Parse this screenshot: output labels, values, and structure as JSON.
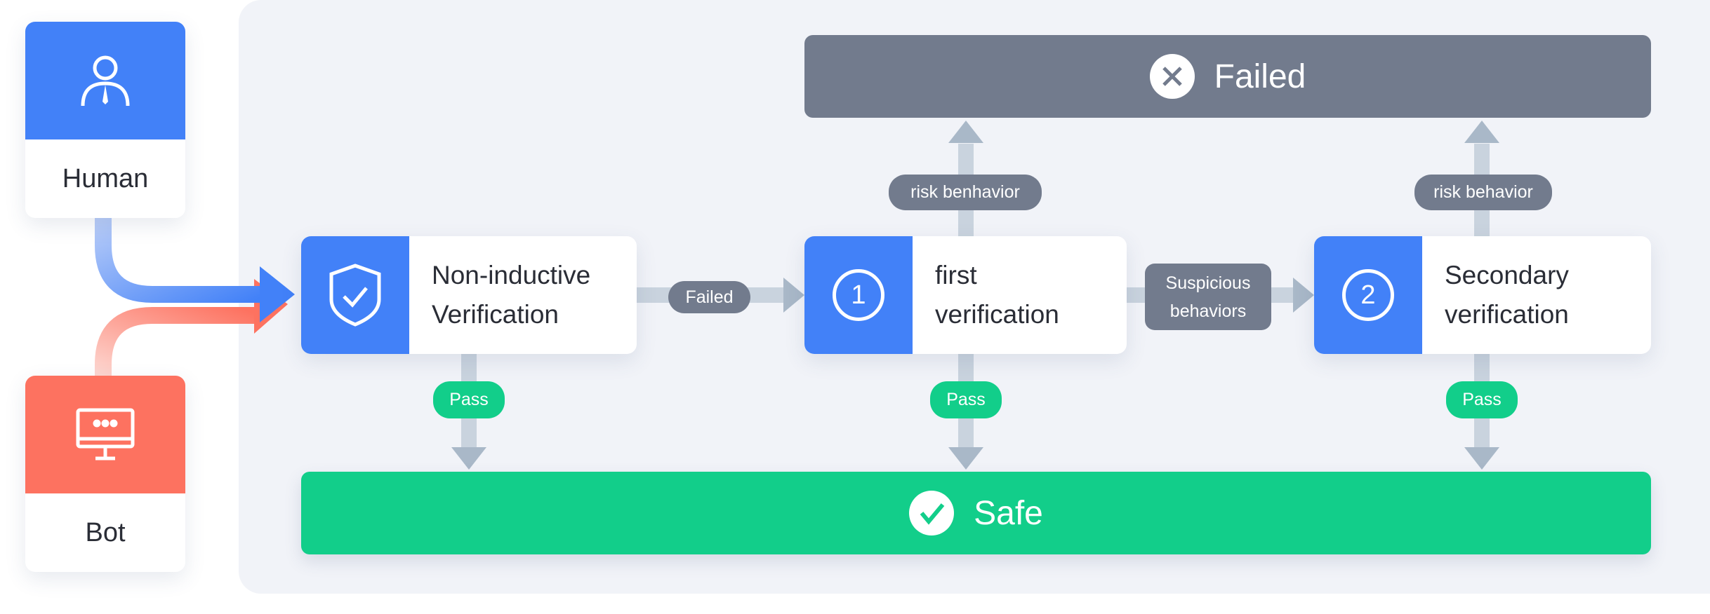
{
  "sources": [
    {
      "label": "Human",
      "icon": "person-icon",
      "color": "#4281f8"
    },
    {
      "label": "Bot",
      "icon": "monitor-icon",
      "color": "#fd7260"
    }
  ],
  "steps": [
    {
      "line1": "Non-inductive",
      "line2": "Verification",
      "icon": "shield-check-icon"
    },
    {
      "line1": "first",
      "line2": "verification",
      "icon": "number-1-icon",
      "num": "1"
    },
    {
      "line1": "Secondary",
      "line2": "verification",
      "icon": "number-2-icon",
      "num": "2"
    }
  ],
  "outcomes": {
    "failed": "Failed",
    "safe": "Safe"
  },
  "edges": {
    "failed": "Failed",
    "suspicious_1": "Suspicious",
    "suspicious_2": "behaviors",
    "risk_1": "risk benhavior",
    "risk_2": "risk behavior",
    "pass": "Pass"
  },
  "colors": {
    "blue": "#4281f8",
    "red": "#fd7260",
    "gray": "#727b8d",
    "green": "#12ce8a"
  }
}
